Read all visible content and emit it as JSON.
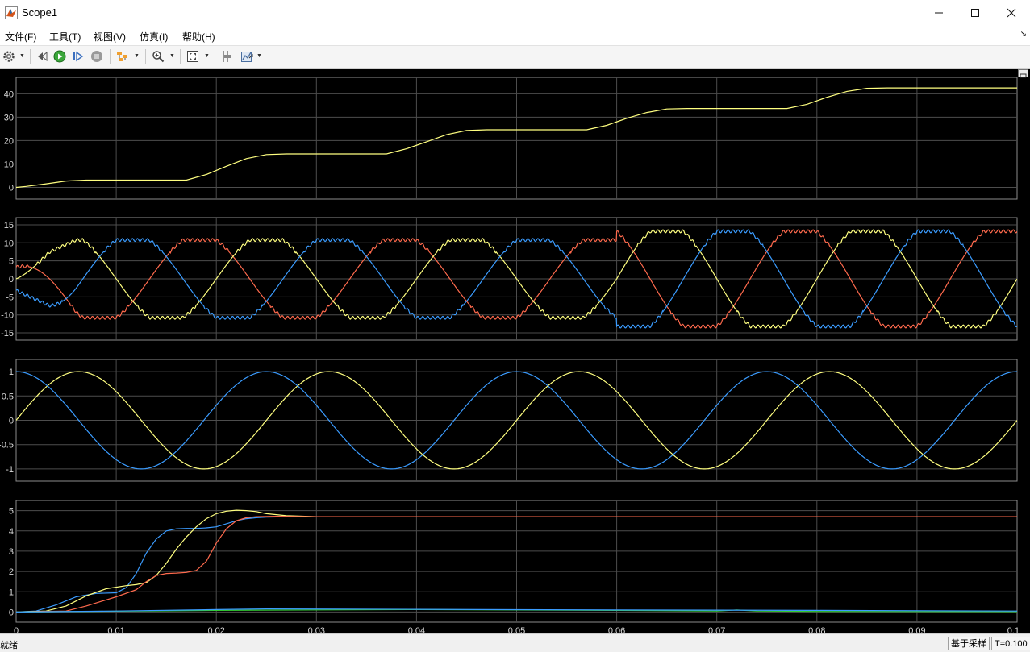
{
  "window": {
    "title": "Scope1"
  },
  "menu": [
    {
      "label": "文件(F)",
      "name": "menu-file"
    },
    {
      "label": "工具(T)",
      "name": "menu-tools"
    },
    {
      "label": "视图(V)",
      "name": "menu-view"
    },
    {
      "label": "仿真(I)",
      "name": "menu-simulation"
    },
    {
      "label": "帮助(H)",
      "name": "menu-help"
    }
  ],
  "toolbar": {
    "icons": [
      "gear-icon",
      "step-back-icon",
      "run-icon",
      "step-forward-icon",
      "stop-icon",
      "highlight-icon",
      "zoom-icon",
      "fit-to-view-icon",
      "cursor-measure-icon",
      "signal-properties-icon"
    ]
  },
  "status": {
    "left": "就绪",
    "mode": "基于采样",
    "time": "T=0.100"
  },
  "colors": {
    "plot_bg": "#000000",
    "axes_bg": "#000000",
    "grid": "#4d4d4d",
    "axis_text": "#d9d9d9",
    "yellow": "#ffff80",
    "blue": "#3b9cff",
    "red": "#ff6a4d",
    "green": "#33cc33"
  },
  "chart_data": [
    {
      "type": "line",
      "x_range": [
        0,
        0.1
      ],
      "ylim": [
        -5,
        47
      ],
      "yticks": [
        "0",
        "10",
        "20",
        "30",
        "40"
      ],
      "series": [
        {
          "color": "yellow",
          "x": [
            0,
            0.001,
            0.003,
            0.005,
            0.007,
            0.009,
            0.013,
            0.017,
            0.019,
            0.021,
            0.023,
            0.025,
            0.027,
            0.029,
            0.033,
            0.037,
            0.039,
            0.041,
            0.043,
            0.045,
            0.047,
            0.049,
            0.053,
            0.057,
            0.059,
            0.061,
            0.063,
            0.065,
            0.067,
            0.069,
            0.073,
            0.077,
            0.079,
            0.081,
            0.083,
            0.085,
            0.087,
            0.089,
            0.093,
            0.097,
            0.1
          ],
          "y": [
            0,
            0.4,
            1.5,
            2.7,
            3.1,
            3.1,
            3.1,
            3.1,
            5.5,
            9,
            12.3,
            14,
            14.3,
            14.3,
            14.3,
            14.3,
            16.5,
            19.5,
            22.5,
            24.3,
            24.6,
            24.6,
            24.6,
            24.6,
            26.5,
            29.5,
            32,
            33.5,
            33.7,
            33.7,
            33.7,
            33.7,
            35.5,
            38.5,
            41,
            42.3,
            42.5,
            42.5,
            42.5,
            42.5,
            42.5
          ]
        }
      ]
    },
    {
      "type": "line",
      "x_range": [
        0,
        0.1
      ],
      "ylim": [
        -17,
        17
      ],
      "yticks": [
        "15",
        "10",
        "5",
        "0",
        "-5",
        "-10",
        "-15"
      ],
      "series": [
        {
          "color": "red",
          "waveform": "phase-current",
          "phase_deg": 240
        },
        {
          "color": "yellow",
          "waveform": "phase-current",
          "phase_deg": 0
        },
        {
          "color": "blue",
          "waveform": "phase-current",
          "phase_deg": 120
        }
      ]
    },
    {
      "type": "line",
      "x_range": [
        0,
        0.1
      ],
      "ylim": [
        -1.25,
        1.25
      ],
      "yticks": [
        "1",
        "0.5",
        "0",
        "-0.5",
        "-1"
      ],
      "series": [
        {
          "color": "yellow",
          "waveform": "sin"
        },
        {
          "color": "blue",
          "waveform": "cos"
        }
      ]
    },
    {
      "type": "line",
      "x_range": [
        0,
        0.1
      ],
      "ylim": [
        -0.5,
        5.5
      ],
      "yticks": [
        "5",
        "4",
        "3",
        "2",
        "1",
        "0"
      ],
      "xticks": [
        "0",
        "0.01",
        "0.02",
        "0.03",
        "0.04",
        "0.05",
        "0.06",
        "0.07",
        "0.08",
        "0.09",
        "0.1"
      ],
      "series": [
        {
          "color": "blue",
          "x": [
            0,
            0.002,
            0.004,
            0.006,
            0.008,
            0.01,
            0.011,
            0.012,
            0.013,
            0.014,
            0.015,
            0.016,
            0.017,
            0.018,
            0.019,
            0.02,
            0.021,
            0.022,
            0.023,
            0.024,
            0.025,
            0.027,
            0.03,
            0.04,
            0.06,
            0.08,
            0.1
          ],
          "y": [
            0,
            0.05,
            0.35,
            0.75,
            0.92,
            0.95,
            1.2,
            1.9,
            2.9,
            3.6,
            4.0,
            4.1,
            4.12,
            4.12,
            4.15,
            4.2,
            4.35,
            4.5,
            4.6,
            4.65,
            4.68,
            4.7,
            4.7,
            4.7,
            4.7,
            4.7,
            4.7
          ]
        },
        {
          "color": "yellow",
          "x": [
            0,
            0.003,
            0.005,
            0.007,
            0.009,
            0.011,
            0.012,
            0.013,
            0.014,
            0.015,
            0.016,
            0.017,
            0.018,
            0.019,
            0.02,
            0.021,
            0.022,
            0.023,
            0.024,
            0.025,
            0.027,
            0.03,
            0.04,
            0.06,
            0.08,
            0.1
          ],
          "y": [
            0,
            0.05,
            0.3,
            0.8,
            1.15,
            1.3,
            1.35,
            1.45,
            1.8,
            2.4,
            3.1,
            3.7,
            4.2,
            4.6,
            4.85,
            4.97,
            5.02,
            5.0,
            4.95,
            4.85,
            4.75,
            4.7,
            4.7,
            4.7,
            4.7,
            4.7
          ]
        },
        {
          "color": "red",
          "x": [
            0,
            0.005,
            0.007,
            0.009,
            0.01,
            0.012,
            0.013,
            0.014,
            0.015,
            0.016,
            0.017,
            0.018,
            0.019,
            0.02,
            0.021,
            0.022,
            0.023,
            0.024,
            0.026,
            0.03,
            0.04,
            0.06,
            0.08,
            0.1
          ],
          "y": [
            0,
            0.05,
            0.3,
            0.6,
            0.75,
            1.1,
            1.5,
            1.8,
            1.9,
            1.92,
            1.95,
            2.05,
            2.5,
            3.4,
            4.1,
            4.5,
            4.65,
            4.7,
            4.72,
            4.7,
            4.7,
            4.7,
            4.7,
            4.7
          ]
        },
        {
          "color": "green",
          "x": [
            0,
            0.02,
            0.04,
            0.06,
            0.07,
            0.072,
            0.074,
            0.08,
            0.1
          ],
          "y": [
            0,
            0.08,
            0.12,
            0.08,
            0.05,
            0.1,
            0.05,
            0.03,
            0.02
          ]
        },
        {
          "color": "blue",
          "x": [
            0,
            0.01,
            0.02,
            0.025,
            0.04,
            0.06,
            0.08,
            0.1
          ],
          "y": [
            0,
            0.05,
            0.12,
            0.15,
            0.13,
            0.1,
            0.08,
            0.05
          ]
        }
      ]
    }
  ]
}
